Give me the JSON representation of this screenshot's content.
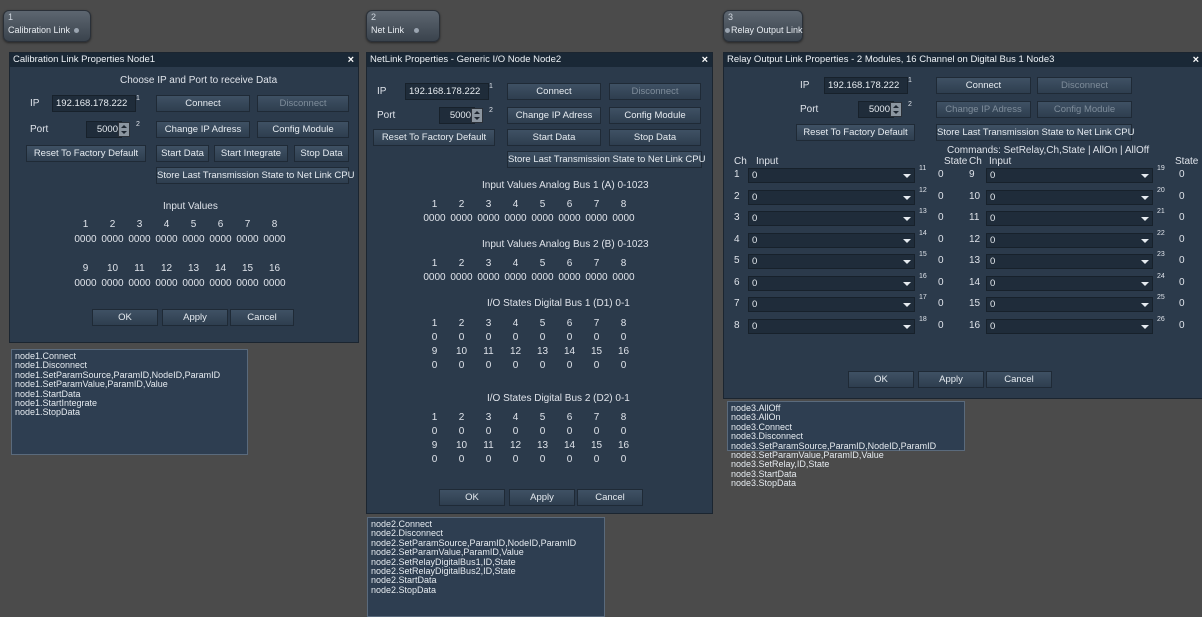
{
  "nodes": [
    {
      "num": "1",
      "title": "Calibration Link"
    },
    {
      "num": "2",
      "title": "Net Link"
    },
    {
      "num": "3",
      "title": "Relay Output Link"
    }
  ],
  "d1": {
    "title": "Calibration Link Properties Node1",
    "close": "×",
    "subtitle": "Choose IP and Port to receive Data",
    "ip_label": "IP",
    "ip": "192.168.178.222",
    "ip_sup": "1",
    "port_label": "Port",
    "port": "5000",
    "port_sup": "2",
    "connect": "Connect",
    "disconnect": "Disconnect",
    "change_ip": "Change IP Adress",
    "config": "Config Module",
    "reset": "Reset To Factory Default",
    "start": "Start Data",
    "start_integrate": "Start Integrate",
    "stop": "Stop Data",
    "store": "Store Last Transmission State to Net Link CPU",
    "input_title": "Input Values",
    "row1_nums": [
      "1",
      "2",
      "3",
      "4",
      "5",
      "6",
      "7",
      "8"
    ],
    "row1_vals": [
      "0000",
      "0000",
      "0000",
      "0000",
      "0000",
      "0000",
      "0000",
      "0000"
    ],
    "row2_nums": [
      "9",
      "10",
      "11",
      "12",
      "13",
      "14",
      "15",
      "16"
    ],
    "row2_vals": [
      "0000",
      "0000",
      "0000",
      "0000",
      "0000",
      "0000",
      "0000",
      "0000"
    ],
    "ok": "OK",
    "apply": "Apply",
    "cancel": "Cancel",
    "commands": [
      "node1.Connect",
      "node1.Disconnect",
      "node1.SetParamSource,ParamID,NodeID,ParamID",
      "node1.SetParamValue,ParamID,Value",
      "node1.StartData",
      "node1.StartIntegrate",
      "node1.StopData"
    ]
  },
  "d2": {
    "title": "NetLink Properties - Generic I/O Node Node2",
    "close": "×",
    "ip_label": "IP",
    "ip": "192.168.178.222",
    "ip_sup": "1",
    "port_label": "Port",
    "port": "5000",
    "port_sup": "2",
    "connect": "Connect",
    "disconnect": "Disconnect",
    "change_ip": "Change IP Adress",
    "config": "Config Module",
    "reset": "Reset To Factory Default",
    "start": "Start Data",
    "stop": "Stop Data",
    "store": "Store Last Transmission State to Net Link CPU",
    "a1_title": "Input Values Analog Bus 1 (A) 0-1023",
    "a1_nums": [
      "1",
      "2",
      "3",
      "4",
      "5",
      "6",
      "7",
      "8"
    ],
    "a1_vals": [
      "0000",
      "0000",
      "0000",
      "0000",
      "0000",
      "0000",
      "0000",
      "0000"
    ],
    "a2_title": "Input Values Analog Bus 2 (B) 0-1023",
    "a2_nums": [
      "1",
      "2",
      "3",
      "4",
      "5",
      "6",
      "7",
      "8"
    ],
    "a2_vals": [
      "0000",
      "0000",
      "0000",
      "0000",
      "0000",
      "0000",
      "0000",
      "0000"
    ],
    "d1_title": "I/O States Digital Bus 1 (D1) 0-1",
    "d1_rows": [
      [
        "1",
        "2",
        "3",
        "4",
        "5",
        "6",
        "7",
        "8"
      ],
      [
        "0",
        "0",
        "0",
        "0",
        "0",
        "0",
        "0",
        "0"
      ],
      [
        "9",
        "10",
        "11",
        "12",
        "13",
        "14",
        "15",
        "16"
      ],
      [
        "0",
        "0",
        "0",
        "0",
        "0",
        "0",
        "0",
        "0"
      ]
    ],
    "d2_title": "I/O States Digital Bus 2 (D2) 0-1",
    "d2_rows": [
      [
        "1",
        "2",
        "3",
        "4",
        "5",
        "6",
        "7",
        "8"
      ],
      [
        "0",
        "0",
        "0",
        "0",
        "0",
        "0",
        "0",
        "0"
      ],
      [
        "9",
        "10",
        "11",
        "12",
        "13",
        "14",
        "15",
        "16"
      ],
      [
        "0",
        "0",
        "0",
        "0",
        "0",
        "0",
        "0",
        "0"
      ]
    ],
    "ok": "OK",
    "apply": "Apply",
    "cancel": "Cancel",
    "commands": [
      "node2.Connect",
      "node2.Disconnect",
      "node2.SetParamSource,ParamID,NodeID,ParamID",
      "node2.SetParamValue,ParamID,Value",
      "node2.SetRelayDigitalBus1,ID,State",
      "node2.SetRelayDigitalBus2,ID,State",
      "node2.StartData",
      "node2.StopData"
    ]
  },
  "d3": {
    "title": "Relay Output Link Properties - 2 Modules, 16 Channel on Digital Bus 1 Node3",
    "close": "×",
    "ip_label": "IP",
    "ip": "192.168.178.222",
    "ip_sup": "1",
    "port_label": "Port",
    "port": "5000",
    "port_sup": "2",
    "connect": "Connect",
    "disconnect": "Disconnect",
    "change_ip": "Change IP Adress",
    "config": "Config Module",
    "reset": "Reset To Factory Default",
    "store": "Store Last Transmission State to Net Link CPU",
    "commands_hint": "Commands: SetRelay,Ch,State | AllOn | AllOff",
    "h_ch": "Ch",
    "h_input": "Input",
    "h_state": "State",
    "left": [
      {
        "ch": "1",
        "val": "0",
        "sup": "11",
        "state": "0"
      },
      {
        "ch": "2",
        "val": "0",
        "sup": "12",
        "state": "0"
      },
      {
        "ch": "3",
        "val": "0",
        "sup": "13",
        "state": "0"
      },
      {
        "ch": "4",
        "val": "0",
        "sup": "14",
        "state": "0"
      },
      {
        "ch": "5",
        "val": "0",
        "sup": "15",
        "state": "0"
      },
      {
        "ch": "6",
        "val": "0",
        "sup": "16",
        "state": "0"
      },
      {
        "ch": "7",
        "val": "0",
        "sup": "17",
        "state": "0"
      },
      {
        "ch": "8",
        "val": "0",
        "sup": "18",
        "state": "0"
      }
    ],
    "right": [
      {
        "ch": "9",
        "val": "0",
        "sup": "19",
        "state": "0"
      },
      {
        "ch": "10",
        "val": "0",
        "sup": "20",
        "state": "0"
      },
      {
        "ch": "11",
        "val": "0",
        "sup": "21",
        "state": "0"
      },
      {
        "ch": "12",
        "val": "0",
        "sup": "22",
        "state": "0"
      },
      {
        "ch": "13",
        "val": "0",
        "sup": "23",
        "state": "0"
      },
      {
        "ch": "14",
        "val": "0",
        "sup": "24",
        "state": "0"
      },
      {
        "ch": "15",
        "val": "0",
        "sup": "25",
        "state": "0"
      },
      {
        "ch": "16",
        "val": "0",
        "sup": "26",
        "state": "0"
      }
    ],
    "ok": "OK",
    "apply": "Apply",
    "cancel": "Cancel",
    "commands": [
      "node3.AllOff",
      "node3.AllOn",
      "node3.Connect",
      "node3.Disconnect",
      "node3.SetParamSource,ParamID,NodeID,ParamID",
      "node3.SetParamValue,ParamID,Value",
      "node3.SetRelay,ID,State",
      "node3.StartData",
      "node3.StopData"
    ]
  }
}
